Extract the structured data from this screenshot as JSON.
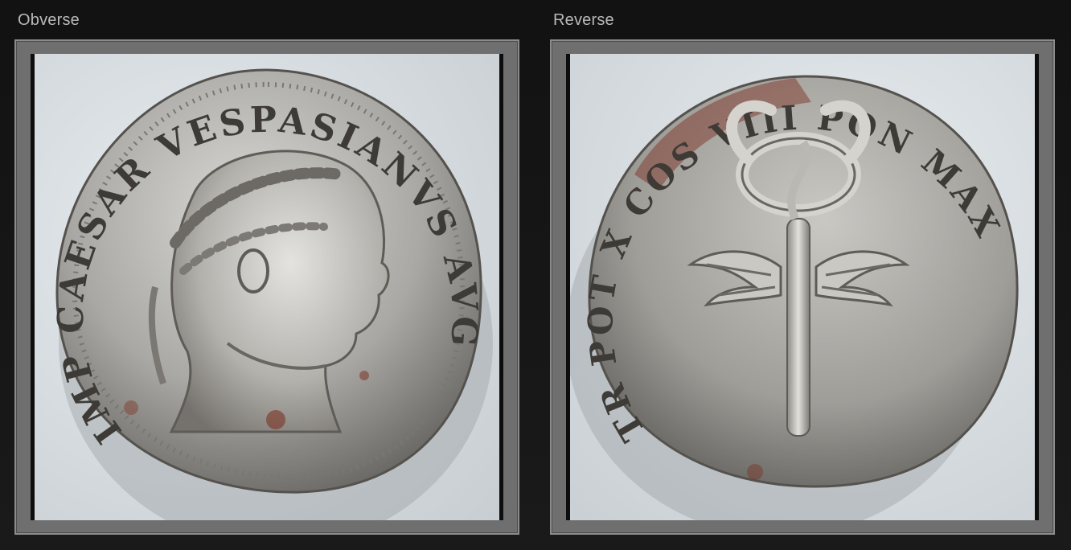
{
  "panels": {
    "obverse": {
      "label": "Obverse",
      "legend": "IMP CAESAR VESPASIANVS AVG"
    },
    "reverse": {
      "label": "Reverse",
      "legend": "TR POT X COS VIII PON MAX"
    }
  },
  "colors": {
    "page_background": "#141414",
    "frame_gray": "#6f6f6f",
    "photo_background": "#dde3e6",
    "silver_light": "#d6d6d6",
    "silver_dark": "#6e6e6e",
    "toning_red": "#7a2a1c"
  },
  "icons": {
    "obverse_image": "laureate-head-right-coin",
    "reverse_image": "winged-caduceus-coin"
  }
}
